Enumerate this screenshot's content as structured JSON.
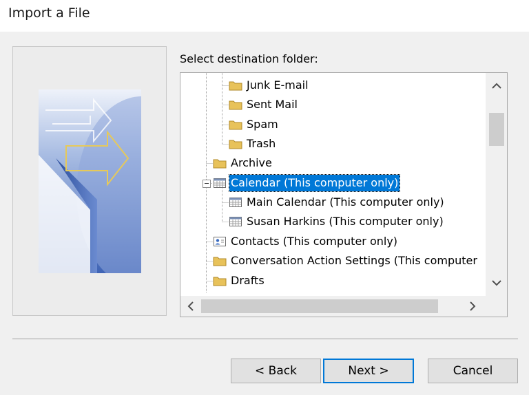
{
  "window": {
    "title": "Import a File"
  },
  "destination": {
    "label": "Select destination folder:",
    "tree": [
      {
        "label": "Junk E-mail",
        "icon": "folder-icon"
      },
      {
        "label": "Sent Mail",
        "icon": "folder-icon"
      },
      {
        "label": "Spam",
        "icon": "folder-icon"
      },
      {
        "label": "Trash",
        "icon": "folder-icon"
      },
      {
        "label": "Archive",
        "icon": "folder-icon"
      },
      {
        "label": "Calendar (This computer only)",
        "icon": "calendar-icon",
        "expanded": true,
        "selected": true
      },
      {
        "label": "Main Calendar (This computer only)",
        "icon": "calendar-icon"
      },
      {
        "label": "Susan Harkins (This computer only)",
        "icon": "calendar-icon"
      },
      {
        "label": "Contacts (This computer only)",
        "icon": "contacts-icon"
      },
      {
        "label": "Conversation Action Settings (This computer",
        "icon": "folder-icon"
      },
      {
        "label": "Drafts",
        "icon": "folder-icon"
      }
    ]
  },
  "scrollbars": {
    "up": "⌃",
    "down": "⌄",
    "left": "‹",
    "right": "›"
  },
  "buttons": {
    "back": "< Back",
    "next": "Next >",
    "cancel": "Cancel"
  },
  "colors": {
    "selection": "#0078d7",
    "folder": "#e8c25a",
    "window_bg": "#f0f0f0"
  }
}
